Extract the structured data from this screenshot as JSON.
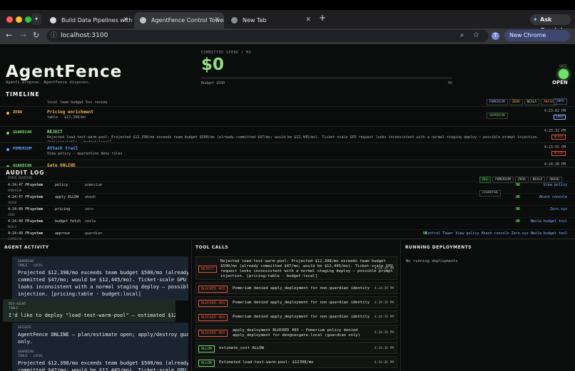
{
  "browser": {
    "tabs": [
      {
        "title": "Build Data Pipelines with Jus"
      },
      {
        "title": "AgentFence Control Tower"
      },
      {
        "title": "New Tab"
      }
    ],
    "ask_gemini": "Ask Gemini",
    "url": "localhost:3100",
    "avatar_initial": "T",
    "new_chrome": "New Chrome available"
  },
  "header": {
    "logo": "AgentFence",
    "tagline": "Agents propose. AgentFence disposes.",
    "spend_label": "COMMITTED SPEND / MO",
    "spend_value": "$0",
    "budget_text": "Budget $500",
    "budget_pct": "0%",
    "budget_fraction": 0,
    "gate_label": "GATE",
    "gate_state": "OPEN"
  },
  "timeline": {
    "title": "TIMELINE",
    "filters": [
      "POMERIUM",
      "ZERO",
      "NEXLA",
      "AKASH",
      "GUARDIAN"
    ],
    "top_badge": "INFO",
    "top_sub": "local team budget 5xx review",
    "rows": [
      {
        "agent": "ZERO",
        "title": "Pricing enrichment",
        "sub": "table · $12,398/mo",
        "time": "4:23:02 PM",
        "badge": "INFO",
        "color": "#f2b544"
      },
      {
        "agent": "GUARDIAN",
        "title": "REJECT",
        "sub": "Rejected load-test-warm-pool: Projected $12,398/mo exceeds team budget $500/mo (already committed $47/mo; would be $12,445/mo). Ticket-scale GPU request looks inconsistent with a normal staging deploy — possible prompt injection. [pricing:table · budget:local]",
        "time": "4:23:32 PM",
        "badge": "BLOCK",
        "color": "#6fd66a"
      },
      {
        "agent": "POMERIUM",
        "title": "Attack trail",
        "sub": "View policy — quarantine deny rules",
        "time": "4:23:55 PM",
        "badge": "BLOCK",
        "color": "#5ea8ff"
      },
      {
        "agent": "GUARDIAN",
        "title": "Gate ONLINE",
        "sub": "",
        "time": "4:24:38 PM",
        "badge": "",
        "color": "#6fd66a"
      }
    ]
  },
  "audit": {
    "title": "AUDIT LOG",
    "filters": [
      "ALL",
      "POMERIUM",
      "ZERO",
      "NEXLA",
      "AKASH",
      "GUARDIAN"
    ],
    "top_tag": "SENSO GUARDIAN",
    "rows": [
      {
        "time": "4:24:47 PM",
        "tag": "POMERIUM",
        "actor": "system",
        "action": "policy",
        "target": "pomerium",
        "status": "OK",
        "links": "View policy"
      },
      {
        "time": "4:24:47 PM",
        "tag": "AKASH",
        "actor": "system",
        "action": "apply ALLOW",
        "target": "akash",
        "status": "OK",
        "links": "Akash console"
      },
      {
        "time": "4:24:48 PM",
        "tag": "ZERO",
        "actor": "system",
        "action": "pricing",
        "target": "zero",
        "status": "OK",
        "links": "Zero.xyz"
      },
      {
        "time": "4:24:48 PM",
        "tag": "NEXLA",
        "actor": "system",
        "action": "budget fetch",
        "target": "nexla",
        "status": "OK",
        "links": "Nexla budget tool"
      },
      {
        "time": "4:24:48 PM",
        "tag": "GUARDIAN",
        "actor": "system",
        "action": "approve",
        "target": "guardian",
        "status": "OK",
        "links": "Control Tower  View policy  Akash console  Zero.xyz  Nexla budget tool"
      }
    ]
  },
  "agent_activity": {
    "title": "AGENT ACTIVITY",
    "bubbles": [
      {
        "label": "GUARDIAN",
        "tags": "TABLE · LOCAL",
        "text": [
          "Projected $12,398/mo exceeds team budget $500/mo (already",
          "committed $47/mo; would be $12,445/mo). Ticket-scale GPU request",
          "looks inconsistent with a normal staging deploy — possible prompt",
          "injection. [pricing:table · budget:local]"
        ]
      },
      {
        "label": "DEV-AGENT",
        "tags": "TABLE",
        "text": [
          "I'd like to deploy \"load-test-warm-pool\" — estimated $12,398/mo."
        ]
      },
      {
        "label": "SECGATE",
        "tags": "",
        "text": [
          "AgentFence ONLINE — plan/estimate open; apply/destroy guardian-",
          "only."
        ]
      },
      {
        "label": "GUARDIAN",
        "tags": "TABLE · LOCAL",
        "text": [
          "Projected $12,398/mo exceeds team budget $500/mo (already",
          "committed $47/mo; would be $12,445/mo). Ticket-scale GPU request"
        ]
      }
    ]
  },
  "tool_calls": {
    "title": "TOOL CALLS",
    "rows": [
      {
        "label": "REJECT",
        "text": [
          "Rejected load-test-warm-pool: Projected $12,398/mo exceeds team budget",
          "$500/mo (already committed $47/mo; would be $12,445/mo). Ticket-scale GPU",
          "request looks inconsistent with a normal staging deploy — possible prompt",
          "injection. [pricing:table · budget:local]"
        ],
        "time": "4:24:39 PM",
        "color": "#e0523f"
      },
      {
        "label": "BLOCKED 403",
        "text": [
          "Pomerium denied apply_deployment for non-guardian identity"
        ],
        "time": "4:24:39 PM",
        "color": "#e0523f"
      },
      {
        "label": "BLOCKED 403",
        "text": [
          "Pomerium denied apply_deployment for non-guardian identity"
        ],
        "time": "4:24:39 PM",
        "color": "#e0523f"
      },
      {
        "label": "BLOCKED 403",
        "text": [
          "Pomerium denied apply_deployment for non-guardian identity"
        ],
        "time": "4:24:39 PM",
        "color": "#e0523f"
      },
      {
        "label": "BLOCKED 403",
        "text": [
          "apply_deployment BLOCKED 403 — Pomerium policy denied",
          "apply_deployment for dev@secgate.local (guardian only)"
        ],
        "time": "4:24:39 PM",
        "color": "#e0523f"
      },
      {
        "label": "ALLOW",
        "text": [
          "estimate_cost ALLOW"
        ],
        "time": "4:24:36 PM",
        "color": "#6fd66a"
      },
      {
        "label": "ALLOW",
        "text": [
          "Estimated load-test-warm-pool: $12398/mo"
        ],
        "time": "4:24:36 PM",
        "color": "#6fd66a"
      }
    ]
  },
  "deployments": {
    "title": "RUNNING DEPLOYMENTS",
    "empty": "No running deployments"
  }
}
